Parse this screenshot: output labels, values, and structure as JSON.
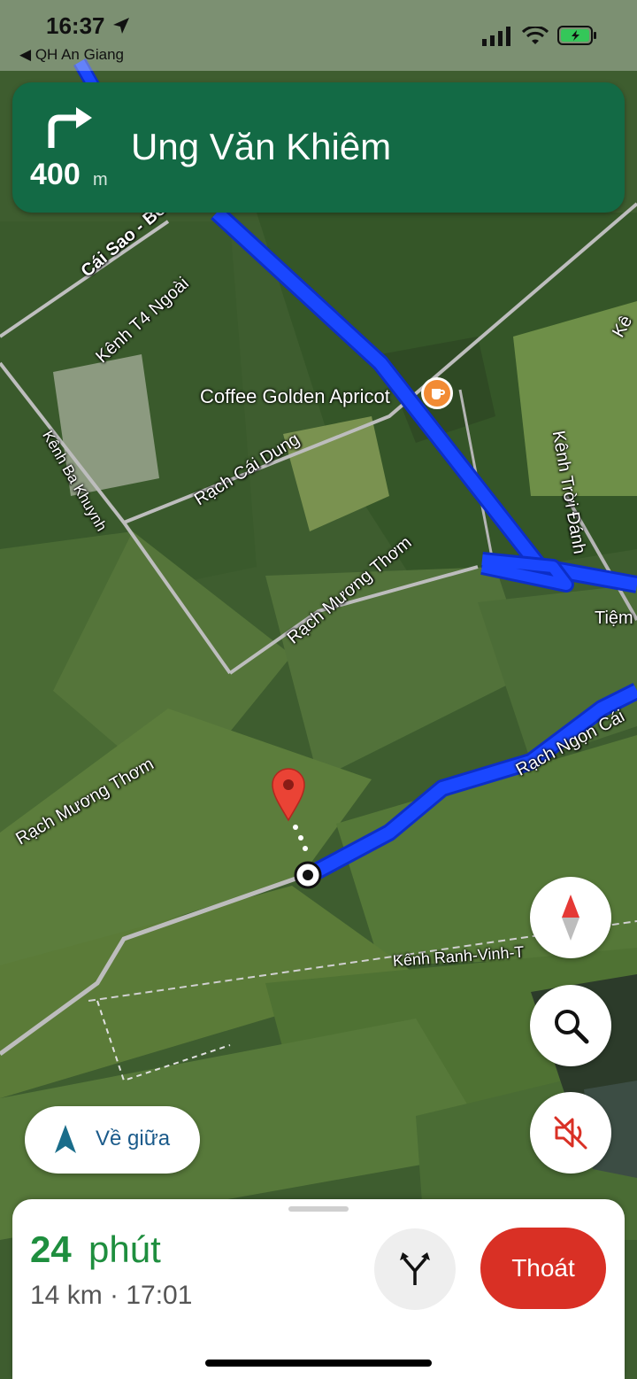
{
  "status_bar": {
    "time": "16:37",
    "back_app": "QH An Giang"
  },
  "nav": {
    "distance": "400",
    "distance_unit": "m",
    "street": "Ung Văn Khiêm"
  },
  "map": {
    "labels": [
      {
        "key": "cai_sao",
        "text": "Cái Sao - Bờ"
      },
      {
        "key": "t4",
        "text": "Kênh T4 Ngoài"
      },
      {
        "key": "ba_khuynh",
        "text": "Kênh Ba Khuynh"
      },
      {
        "key": "cai_dung",
        "text": "Rạch Cái Dung"
      },
      {
        "key": "troi_danh",
        "text": "Kênh Trời Đánh"
      },
      {
        "key": "muong_thom_1",
        "text": "Rạch Mương Thơm"
      },
      {
        "key": "muong_thom_2",
        "text": "Rạch Mương Thơm"
      },
      {
        "key": "tiem",
        "text": "Tiệm"
      },
      {
        "key": "ngon_cai",
        "text": "Rạch Ngọn Cái"
      },
      {
        "key": "ranh_vinh",
        "text": "Kênh Ranh-Vinh-T"
      },
      {
        "key": "ke_right",
        "text": "Kê"
      }
    ],
    "poi": {
      "name": "Coffee Golden Apricot",
      "icon": "coffee-icon"
    },
    "route_color": "#1a47ff"
  },
  "controls": {
    "recenter_label": "Về giữa"
  },
  "trip": {
    "eta_value": "24",
    "eta_unit": "phút",
    "details": "14 km · 17:01",
    "exit_label": "Thoát"
  },
  "colors": {
    "banner": "#136a45",
    "eta": "#1e8e3e",
    "exit": "#d93025"
  }
}
